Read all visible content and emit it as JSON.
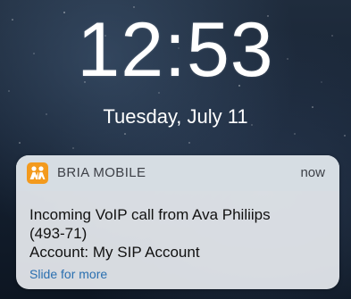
{
  "lockscreen": {
    "time": "12:53",
    "date": "Tuesday, July 11"
  },
  "notification": {
    "app_icon": "bria-app-icon",
    "app_name": "BRIA MOBILE",
    "time": "now",
    "lines": [
      "Incoming VoIP call from Ava Philiips",
      "(493-71)",
      "Account: My SIP Account"
    ],
    "hint": "Slide for more"
  },
  "colors": {
    "app_icon_bg": "#f39a1d",
    "hint_text": "#2a6fb0"
  }
}
